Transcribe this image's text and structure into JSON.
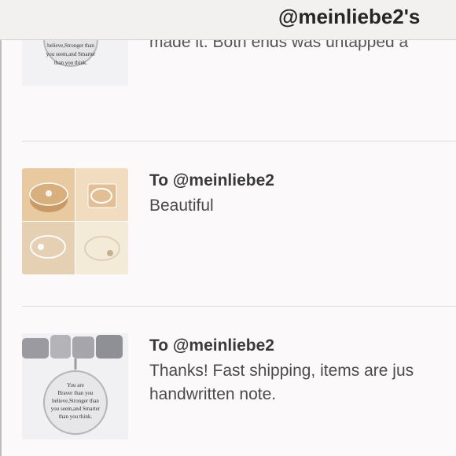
{
  "header": {
    "title": "@meinliebe2's"
  },
  "reviews": [
    {
      "text": "made it. Both ends was untapped a",
      "thumb_caption": [
        "believe,Stronger than",
        "you seem,and Smarter",
        "than you think."
      ]
    },
    {
      "to": "To @meinliebe2",
      "text": "Beautiful"
    },
    {
      "to": "To @meinliebe2",
      "text": "Thanks! Fast shipping, items are jus handwritten note.",
      "thumb_caption": [
        "You are",
        "Braver than you",
        "believe,Stronger than",
        "you seem,and Smarter",
        "than you think."
      ]
    }
  ],
  "colors": {
    "background": "#fbf9f9",
    "header_bg": "#f3f1ef",
    "text": "#4a4a4a"
  }
}
